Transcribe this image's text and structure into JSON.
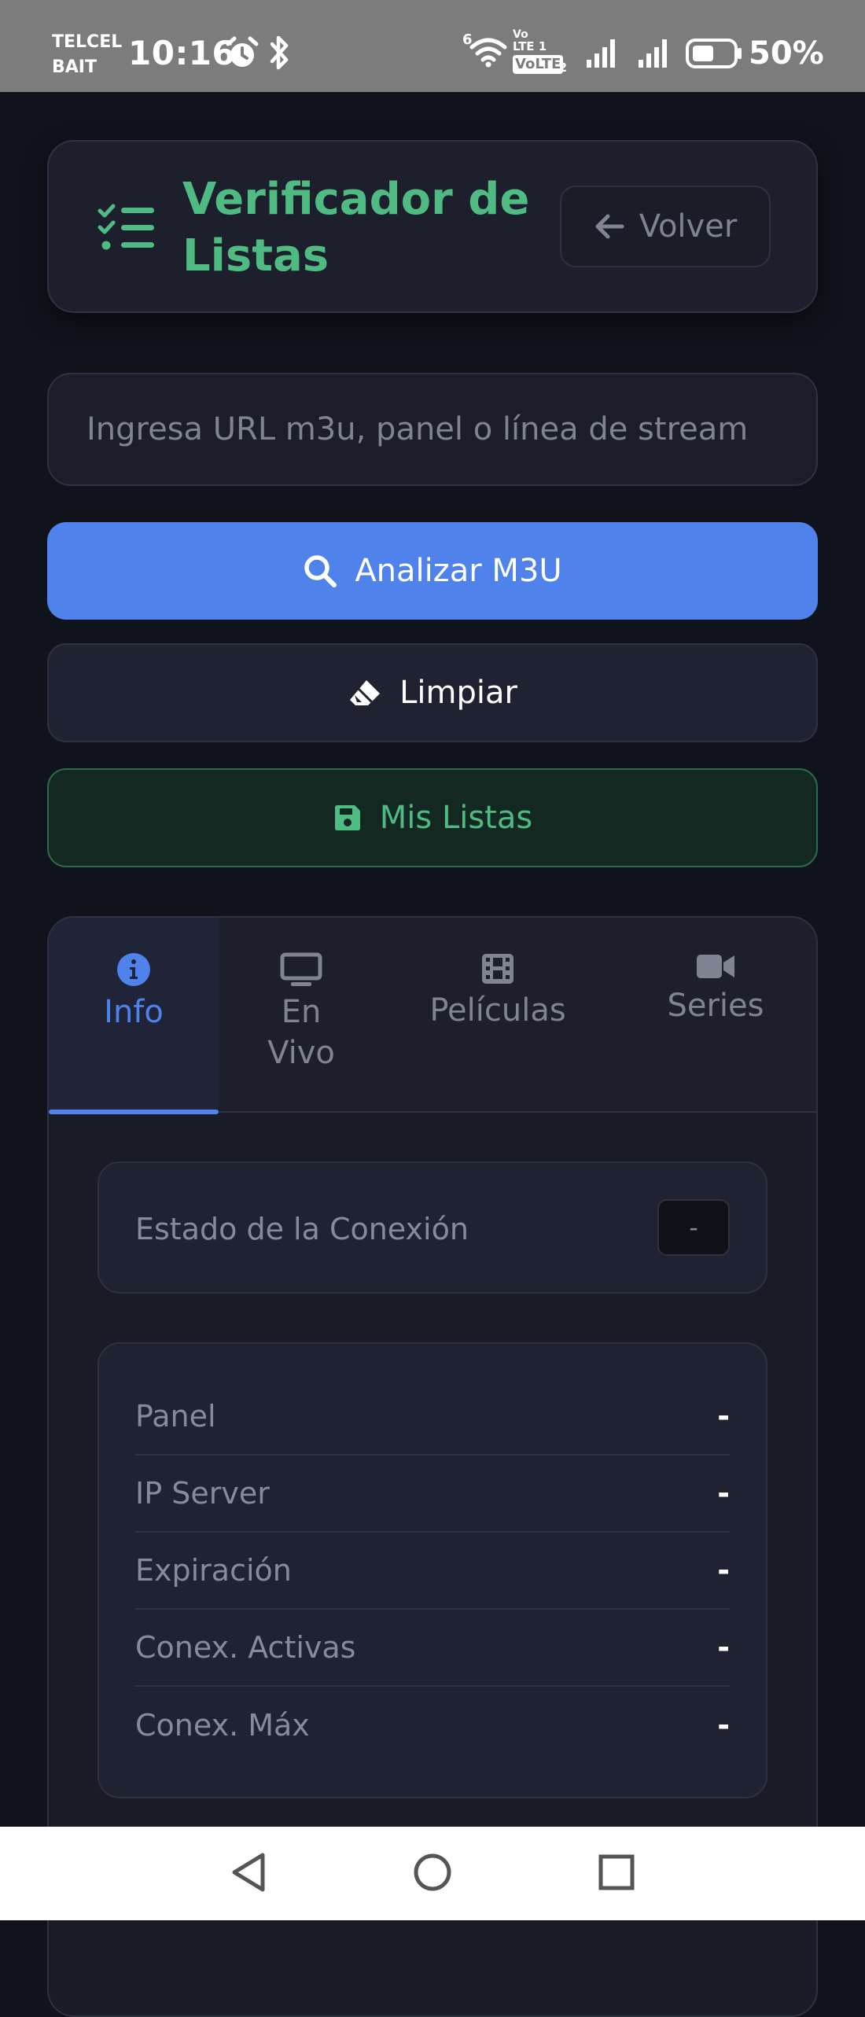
{
  "status_bar": {
    "carrier_line1": "TELCEL",
    "carrier_line2": "BAIT",
    "time": "10:16",
    "network_small": "6",
    "volte_top": "Vo",
    "lte_label": "LTE 1",
    "volte_label": "VoLTE",
    "volte_sim": "2",
    "battery_percent": "50%"
  },
  "header": {
    "title": "Verificador de Listas",
    "back_label": "Volver"
  },
  "search": {
    "placeholder": "Ingresa URL m3u, panel o línea de stream"
  },
  "actions": {
    "analyze_label": "Analizar M3U",
    "clear_label": "Limpiar",
    "my_lists_label": "Mis Listas"
  },
  "tabs": [
    {
      "label": "Info",
      "icon": "info-circle-icon"
    },
    {
      "label": "En Vivo",
      "icon": "tv-icon"
    },
    {
      "label": "Películas",
      "icon": "film-icon"
    },
    {
      "label": "Series",
      "icon": "video-camera-icon"
    }
  ],
  "connection": {
    "label": "Estado de la Conexión",
    "value": "-"
  },
  "details": [
    {
      "label": "Panel",
      "value": "-"
    },
    {
      "label": "IP Server",
      "value": "-"
    },
    {
      "label": "Expiración",
      "value": "-"
    },
    {
      "label": "Conex. Activas",
      "value": "-"
    },
    {
      "label": "Conex. Máx",
      "value": "-"
    }
  ],
  "colors": {
    "accent_blue": "#5082ec",
    "accent_green": "#4fbb82",
    "background": "#10131b",
    "card": "#1d202c"
  }
}
